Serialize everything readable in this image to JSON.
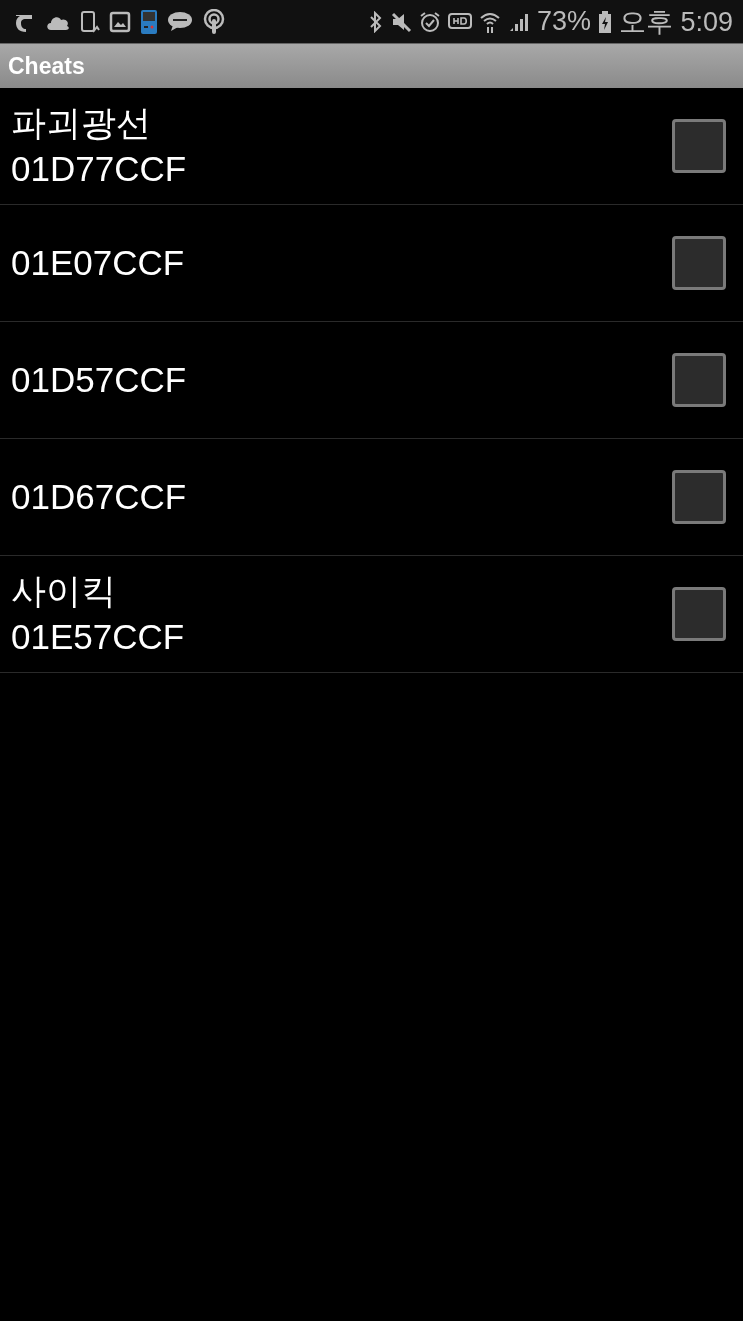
{
  "status_bar": {
    "battery": "73%",
    "time": "오후 5:09"
  },
  "title_bar": {
    "title": "Cheats"
  },
  "cheats": [
    {
      "name": "파괴광선",
      "code": "01D77CCF",
      "checked": false
    },
    {
      "code": "01E07CCF",
      "checked": false
    },
    {
      "code": "01D57CCF",
      "checked": false
    },
    {
      "code": "01D67CCF",
      "checked": false
    },
    {
      "name": "사이킥",
      "code": "01E57CCF",
      "checked": false
    }
  ]
}
